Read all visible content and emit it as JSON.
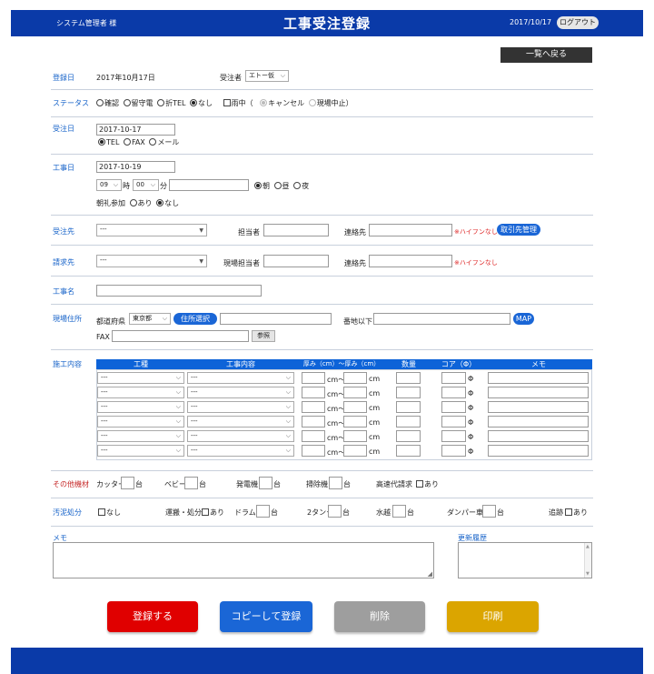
{
  "header": {
    "user": "システム管理者 様",
    "title": "工事受注登録",
    "date": "2017/10/17",
    "logout_label": "ログアウト",
    "color": "#0a3aa8"
  },
  "back_label": "一覧へ戻る",
  "registration": {
    "label": "登録日",
    "date": "2017年10月17日",
    "receiver_label": "受注者",
    "receiver_value": "エトー仮"
  },
  "status": {
    "label": "ステータス",
    "options": [
      "確認",
      "留守電",
      "折TEL",
      "なし"
    ],
    "selected": "なし",
    "rain_label": "雨中（",
    "rain_options": [
      "キャンセル",
      "現場中止）"
    ]
  },
  "order_date": {
    "label": "受注日",
    "value": "2017-10-17",
    "methods": [
      "TEL",
      "FAX",
      "メール"
    ],
    "selected": "TEL"
  },
  "work_date": {
    "label": "工事日",
    "value": "2017-10-19",
    "hour": "09",
    "hour_unit": "時",
    "minute": "00",
    "minute_unit": "分",
    "periods": [
      "朝",
      "昼",
      "夜"
    ],
    "period_selected": "朝",
    "morning_label": "朝礼参加",
    "morning_options": [
      "あり",
      "なし"
    ],
    "morning_selected": "なし"
  },
  "customer": {
    "label": "受注先",
    "value": "---",
    "person_label": "担当者",
    "contact_label": "連絡先",
    "note": "※ハイフンなし",
    "manage_label": "取引先管理"
  },
  "billing": {
    "label": "請求先",
    "value": "---",
    "person_label": "現場担当者",
    "contact_label": "連絡先",
    "note": "※ハイフンなし"
  },
  "work_name": {
    "label": "工事名"
  },
  "site": {
    "label": "現場住所",
    "pref_label": "都道府県",
    "pref_value": "東京都",
    "address_button": "住所選択",
    "street_label": "番地以下",
    "map_label": "MAP",
    "fax_label": "FAX",
    "ref_label": "参照"
  },
  "construction": {
    "label": "施工内容",
    "headers": [
      "工種",
      "工事内容",
      "厚み（cm）〜厚み（cm）",
      "数量",
      "コア（Φ）",
      "メモ"
    ],
    "rows": [
      {
        "type": "---",
        "content": "---"
      },
      {
        "type": "---",
        "content": "---"
      },
      {
        "type": "---",
        "content": "---"
      },
      {
        "type": "---",
        "content": "---"
      },
      {
        "type": "---",
        "content": "---"
      },
      {
        "type": "---",
        "content": "---"
      }
    ],
    "cm1": "cm〜",
    "cm2": "cm",
    "phi": "Φ"
  },
  "equipment": {
    "label": "その他機材",
    "items": [
      {
        "name": "カッター",
        "unit": "台"
      },
      {
        "name": "ベビー",
        "unit": "台"
      },
      {
        "name": "発電機",
        "unit": "台"
      },
      {
        "name": "掃除機",
        "unit": "台"
      }
    ],
    "highway_label": "高速代請求",
    "highway_check": "あり"
  },
  "sludge": {
    "label": "汚泥処分",
    "none_label": "なし",
    "transport_label": "運搬・処分",
    "transport_check": "あり",
    "drum_label": "ドラム",
    "drum_unit": "台",
    "tank_label": "2タンク",
    "tank_unit": "台",
    "water_label": "水越",
    "water_unit": "台",
    "dump_label": "ダンパー車",
    "dump_unit": "台",
    "extra_label": "追跡",
    "extra_check": "あり"
  },
  "memo_label": "メモ",
  "history_label": "更新履歴",
  "buttons": {
    "register": "登録する",
    "copy": "コピーして登録",
    "delete": "削除",
    "print": "印刷",
    "colors": {
      "register": "#e00000",
      "copy": "#1a66d6",
      "delete": "#9e9e9e",
      "print": "#dba500"
    }
  }
}
